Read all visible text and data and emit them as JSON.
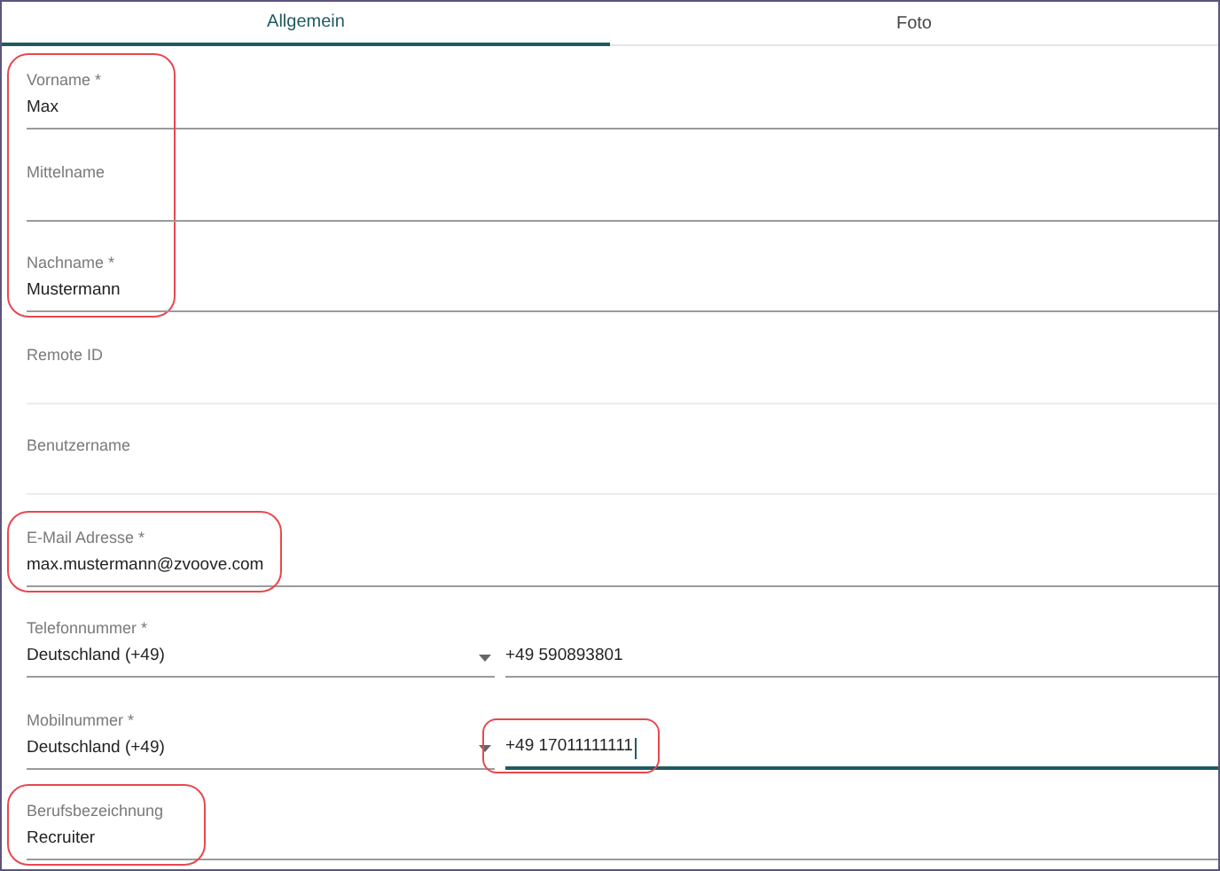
{
  "tabs": [
    {
      "label": "Allgemein",
      "selected": true
    },
    {
      "label": "Foto",
      "selected": false
    }
  ],
  "fields": [
    {
      "kind": "text",
      "label": "Vorname *",
      "value": "Max",
      "highlighted": true
    },
    {
      "kind": "text",
      "label": "Mittelname",
      "highlighted": true
    },
    {
      "kind": "text",
      "label": "Nachname *",
      "value": "Mustermann",
      "highlighted": true
    },
    {
      "kind": "text",
      "label": "Remote ID",
      "disabled": true,
      "highlighted": false
    },
    {
      "kind": "text",
      "label": "Benutzername",
      "disabled": true,
      "highlighted": false
    },
    {
      "kind": "text",
      "label": "E-Mail Adresse *",
      "value": "max.mustermann@zvoove.com",
      "highlighted": true
    },
    {
      "kind": "phone",
      "label": "Telefonnummer *",
      "country": "Deutschland (+49)",
      "number": "+49 590893801",
      "focused": false,
      "number_highlighted": false
    },
    {
      "kind": "phone",
      "label": "Mobilnummer *",
      "country": "Deutschland (+49)",
      "number": "+49 17011111111",
      "focused": true,
      "number_highlighted": true
    },
    {
      "kind": "text",
      "label": "Berufsbezeichnung",
      "value": "Recruiter",
      "highlighted": true
    }
  ]
}
